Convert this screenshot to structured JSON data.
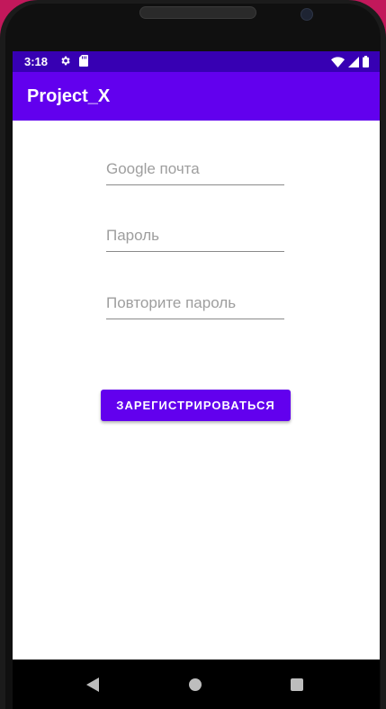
{
  "status_bar": {
    "time": "3:18",
    "icons": [
      "gear-icon",
      "sd-card-icon",
      "wifi-icon",
      "signal-icon",
      "battery-icon"
    ]
  },
  "app_bar": {
    "title": "Project_X"
  },
  "form": {
    "email": {
      "value": "",
      "placeholder": "Google почта"
    },
    "password": {
      "value": "",
      "placeholder": "Пароль"
    },
    "repeat_password": {
      "value": "",
      "placeholder": "Повторите пароль"
    },
    "register_label": "ЗАРЕГИСТРИРОВАТЬСЯ"
  },
  "nav_bar": {
    "icons": [
      "back-icon",
      "home-icon",
      "recents-icon"
    ]
  },
  "colors": {
    "status_bar": "#3700b3",
    "app_bar": "#6200ee",
    "button": "#6200ee",
    "background": "#c2185b"
  }
}
